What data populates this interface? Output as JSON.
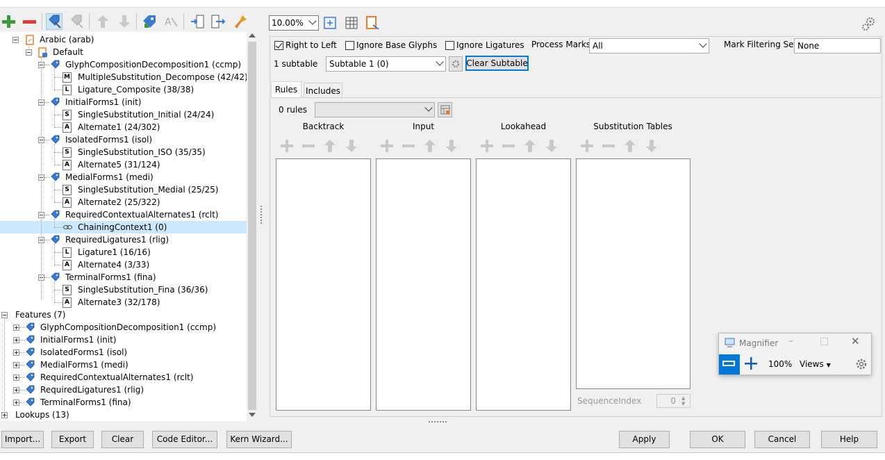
{
  "toolbar": {
    "icons": [
      "add-icon",
      "remove-icon",
      "edit-feature-icon",
      "edit-lookup-icon",
      "move-up-icon",
      "move-down-icon",
      "tag-icon",
      "unicode-icon",
      "import-icon",
      "export-icon",
      "clean-icon"
    ]
  },
  "tree": {
    "script": "Arabic (arab)",
    "language": "Default",
    "lookups": [
      {
        "label": "GlyphCompositionDecomposition1 (ccmp)",
        "children": [
          {
            "badge": "M",
            "label": "MultipleSubstitution_Decompose (42/42)"
          },
          {
            "badge": "L",
            "label": "Ligature_Composite (38/38)"
          }
        ]
      },
      {
        "label": "InitialForms1 (init)",
        "children": [
          {
            "badge": "S",
            "label": "SingleSubstitution_Initial (24/24)"
          },
          {
            "badge": "A",
            "label": "Alternate1 (24/302)"
          }
        ]
      },
      {
        "label": "IsolatedForms1 (isol)",
        "children": [
          {
            "badge": "S",
            "label": "SingleSubstitution_ISO (35/35)"
          },
          {
            "badge": "A",
            "label": "Alternate5 (31/124)"
          }
        ]
      },
      {
        "label": "MedialForms1 (medi)",
        "children": [
          {
            "badge": "S",
            "label": "SingleSubstitution_Medial (25/25)"
          },
          {
            "badge": "A",
            "label": "Alternate2 (25/322)"
          }
        ]
      },
      {
        "label": "RequiredContextualAlternates1 (rclt)",
        "children": [
          {
            "badge": "C",
            "label": "ChainingContext1 (0)",
            "selected": true
          }
        ]
      },
      {
        "label": "RequiredLigatures1 (rlig)",
        "children": [
          {
            "badge": "L",
            "label": "Ligature1 (16/16)"
          },
          {
            "badge": "A",
            "label": "Alternate4 (3/33)"
          }
        ]
      },
      {
        "label": "TerminalForms1 (fina)",
        "children": [
          {
            "badge": "S",
            "label": "SingleSubstitution_Fina (36/36)"
          },
          {
            "badge": "A",
            "label": "Alternate3 (32/178)"
          }
        ]
      }
    ],
    "features_label": "Features (7)",
    "features": [
      "GlyphCompositionDecomposition1 (ccmp)",
      "InitialForms1 (init)",
      "IsolatedForms1 (isol)",
      "MedialForms1 (medi)",
      "RequiredContextualAlternates1 (rclt)",
      "RequiredLigatures1 (rlig)",
      "TerminalForms1 (fina)"
    ],
    "lookups_label": "Lookups (13)"
  },
  "zoom": {
    "value": "10.00%"
  },
  "options": {
    "right_to_left": "Right to Left",
    "ignore_base": "Ignore Base Glyphs",
    "ignore_lig": "Ignore Ligatures",
    "process_marks_label": "Process Marks:",
    "process_marks_value": "All",
    "mark_filter_label": "Mark Filtering Set:",
    "mark_filter_value": "None"
  },
  "subtable": {
    "count": "1 subtable",
    "selected": "Subtable 1 (0)",
    "clear": "Clear Subtable"
  },
  "tabs": {
    "rules": "Rules",
    "includes": "Includes"
  },
  "rules": {
    "count": "0 rules",
    "columns": [
      "Backtrack",
      "Input",
      "Lookahead",
      "Substitution Tables"
    ],
    "sequence_label": "SequenceIndex",
    "sequence_value": "0"
  },
  "magnifier": {
    "title": "Magnifier",
    "zoom": "100%",
    "views": "Views"
  },
  "buttons": {
    "import": "Import...",
    "export": "Export",
    "clear": "Clear",
    "code_editor": "Code Editor...",
    "kern_wizard": "Kern Wizard...",
    "apply": "Apply",
    "ok": "OK",
    "cancel": "Cancel",
    "help": "Help"
  },
  "colors": {
    "selection": "#cce8ff",
    "focus": "#0078d7",
    "add_green": "#3c9a3c",
    "remove_red": "#e03c31",
    "icon_blue": "#3a7bd5",
    "icon_orange": "#e87e2d"
  }
}
